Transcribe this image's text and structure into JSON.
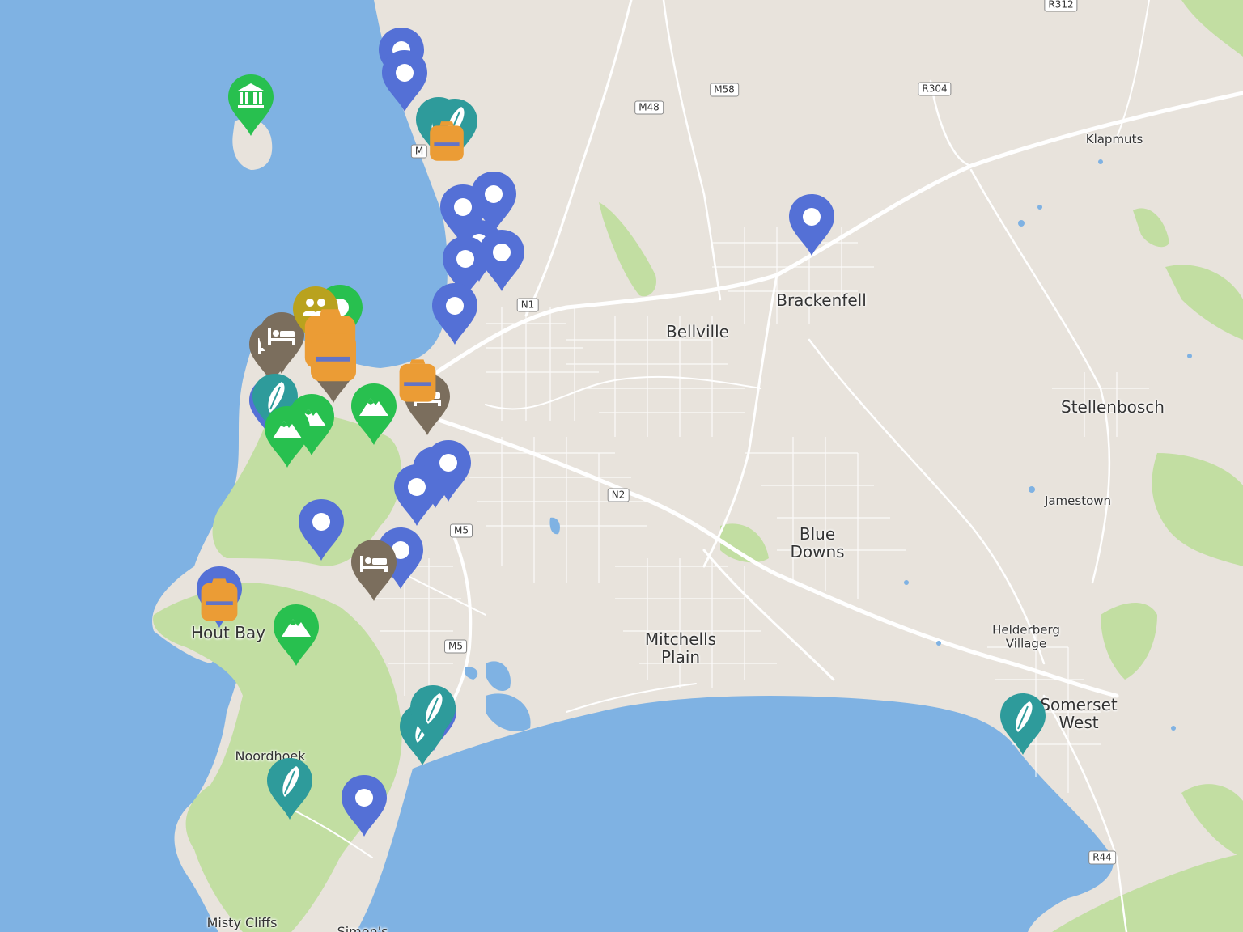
{
  "map": {
    "colors": {
      "water": "#7fb2e3",
      "land": "#e8e3dc",
      "park": "#c2dea2",
      "road": "#ffffff",
      "marker_blue": "#5470d6",
      "marker_green": "#28c04f",
      "marker_teal": "#2e9b9b",
      "marker_brown": "#7b6e5d",
      "marker_orange": "#eb9c35"
    },
    "places": {
      "klapmuts": "Klapmuts",
      "brackenfell": "Brackenfell",
      "bellville": "Bellville",
      "stellenbosch": "Stellenbosch",
      "jamestown": "Jamestown",
      "blue_downs": "Blue\nDowns",
      "mitchells_plain": "Mitchells\nPlain",
      "helderberg_village": "Helderberg\nVillage",
      "somerset_west": "Somerset\nWest",
      "hout_bay": "Hout Bay",
      "noordhoek": "Noordhoek",
      "misty_cliffs": "Misty Cliffs",
      "simons_town_partial": "Simon's"
    },
    "road_shields": {
      "r312": "R312",
      "m58": "M58",
      "r304": "R304",
      "m48": "M48",
      "n1": "N1",
      "n2": "N2",
      "m5_a": "M5",
      "m5_b": "M5",
      "r44": "R44",
      "m_partial": "M"
    },
    "marker_icons": {
      "blue": "dot-icon",
      "green_mountain": "mountain-icon",
      "green_museum": "museum-icon",
      "teal": "surfboard-icon",
      "brown": "bed-icon",
      "olive": "group-icon",
      "orange": "backpack-icon"
    }
  }
}
